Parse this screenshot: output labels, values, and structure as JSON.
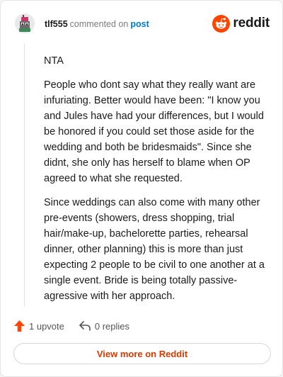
{
  "comment": {
    "username": "tlf555",
    "commented_text": "commented on",
    "post_link": "post"
  },
  "brand": {
    "wordmark": "reddit",
    "accent_color": "#ff4500"
  },
  "body": {
    "paragraphs": [
      "NTA",
      "People who dont say what they really want are infuriating. Better would have been: \"I know you and Jules have had your differences, but I would be honored if you could set those aside for the wedding and both be bridesmaids\". Since she didnt, she only has herself to blame when OP agreed to what she requested.",
      "Since weddings can also come with many other pre-events (showers, dress shopping, trial hair/make-up, bachelorette parties, rehearsal dinner, other planning) this is more than just expecting 2 people to be civil to one another at a single event. Bride is being totally passive-agressive with her approach."
    ]
  },
  "actions": {
    "upvotes": "1 upvote",
    "replies": "0 replies"
  },
  "footer": {
    "view_more": "View more on Reddit",
    "link_color": "#d93a00"
  },
  "icons": [
    "avatar",
    "reddit-logo-icon",
    "upvote-arrow-icon",
    "reply-icon"
  ]
}
